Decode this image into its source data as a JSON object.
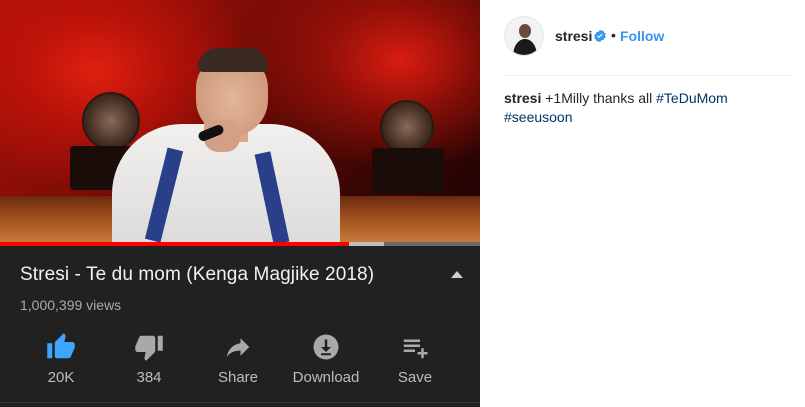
{
  "video": {
    "title": "Stresi - Te du mom (Kenga Magjike 2018)",
    "views": "1,000,399 views",
    "progress_fraction": 0.727,
    "buffered_fraction": 0.8,
    "actions": {
      "like": "20K",
      "dislike": "384",
      "share": "Share",
      "download": "Download",
      "save": "Save"
    },
    "colors": {
      "accent_like": "#3ea6ff",
      "progress": "#ff0000"
    }
  },
  "post": {
    "username": "stresi",
    "separator": "•",
    "follow_label": "Follow",
    "caption_user": "stresi",
    "caption_text": "+1Milly thanks all",
    "hashtags": [
      "#TeDuMom",
      "#seeusoon"
    ],
    "colors": {
      "link": "#3897f0",
      "hashtag": "#003569",
      "verified": "#3897f0"
    }
  }
}
